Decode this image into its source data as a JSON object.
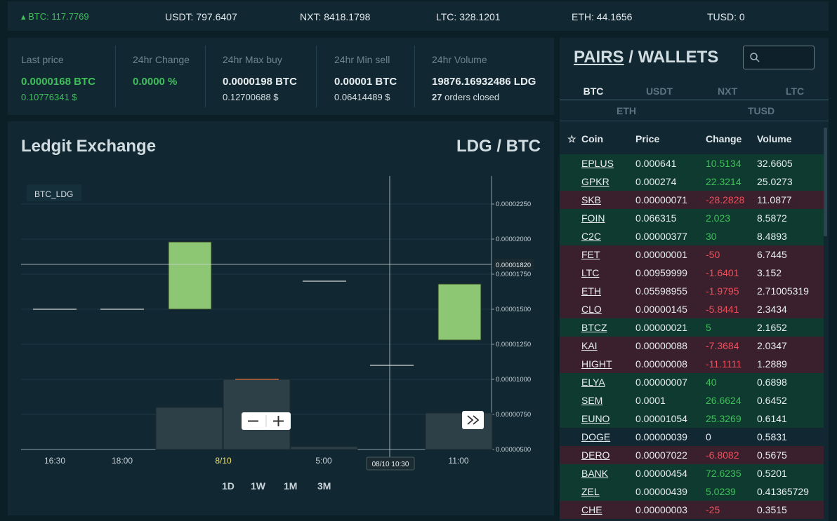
{
  "ticker": [
    {
      "label": "▴ BTC: 117.7769",
      "trend": "up"
    },
    {
      "label": "USDT: 797.6407",
      "trend": "none"
    },
    {
      "label": "NXT: 8418.1798",
      "trend": "none"
    },
    {
      "label": "LTC: 328.1201",
      "trend": "none"
    },
    {
      "label": "ETH: 44.1656",
      "trend": "none"
    },
    {
      "label": "TUSD: 0",
      "trend": "none"
    }
  ],
  "stats": {
    "last_price": {
      "label": "Last price",
      "value": "0.0000168 BTC",
      "sub": "0.10776341 $"
    },
    "change": {
      "label": "24hr Change",
      "value": "0.0000 %"
    },
    "max_buy": {
      "label": "24hr Max buy",
      "value": "0.0000198 BTC",
      "sub": "0.12700688 $"
    },
    "min_sell": {
      "label": "24hr Min sell",
      "value": "0.00001 BTC",
      "sub": "0.06414489 $"
    },
    "volume": {
      "label": "24hr Volume",
      "value": "19876.16932486 LDG",
      "orders_count": "27",
      "orders_label": "orders closed"
    }
  },
  "chart_panel": {
    "title": "Ledgit Exchange",
    "pair": "LDG / BTC",
    "periods": [
      "1D",
      "1W",
      "1M",
      "3M"
    ]
  },
  "chart_data": {
    "type": "candlestick",
    "symbol": "BTC_LDG",
    "x_ticks": [
      "16:30",
      "18:00",
      "8/10",
      "5:00",
      "10:30",
      "11:00"
    ],
    "y_ticks": [
      "0.00002250",
      "0.00002000",
      "0.00001750",
      "0.00001500",
      "0.00001250",
      "0.00001000",
      "0.00000750",
      "0.00000500"
    ],
    "ylim": [
      5e-06,
      2.45e-05
    ],
    "crosshair": {
      "price_label": "0.00001820",
      "price": 1.82e-05,
      "time_label": "08/10 10:30"
    },
    "candles": [
      {
        "time": "16:30",
        "open": 1.5e-05,
        "close": 1.5e-05,
        "volume": 0
      },
      {
        "time": "18:00",
        "open": 1.5e-05,
        "close": 1.5e-05,
        "volume": 0
      },
      {
        "time": "19:30",
        "open": 1.5e-05,
        "close": 1.98e-05,
        "volume": 0.3
      },
      {
        "time": "8/10",
        "open": 1e-05,
        "close": 1e-05,
        "volume": 0.5
      },
      {
        "time": "5:00",
        "open": 1.7e-05,
        "close": 1.7e-05,
        "volume": 0.02
      },
      {
        "time": "10:30",
        "open": 1.1e-05,
        "close": 1.1e-05,
        "volume": 0
      },
      {
        "time": "11:00",
        "open": 1.28e-05,
        "close": 1.68e-05,
        "volume": 0.26
      }
    ],
    "colors": {
      "up": "#8dc774",
      "flat": "#d8d8d8",
      "volume": "#2d4048",
      "grid": "#1e3944"
    }
  },
  "pairs_panel": {
    "pairs_label": "PAIRS",
    "sep": " / ",
    "wallets_label": "WALLETS",
    "tabs_row1": [
      "BTC",
      "USDT",
      "NXT",
      "LTC"
    ],
    "tabs_row2": [
      "ETH",
      "TUSD"
    ],
    "active_tab": "BTC",
    "columns": [
      "Coin",
      "Price",
      "Change",
      "Volume"
    ],
    "rows": [
      {
        "coin": "EPLUS",
        "price": "0.000641",
        "change": "10.5134",
        "volume": "32.6605",
        "dir": "pos"
      },
      {
        "coin": "GPKR",
        "price": "0.000274",
        "change": "22.3214",
        "volume": "25.0273",
        "dir": "pos"
      },
      {
        "coin": "SKB",
        "price": "0.00000071",
        "change": "-28.2828",
        "volume": "11.0877",
        "dir": "neg"
      },
      {
        "coin": "FOIN",
        "price": "0.066315",
        "change": "2.023",
        "volume": "8.5872",
        "dir": "pos"
      },
      {
        "coin": "C2C",
        "price": "0.00000377",
        "change": "30",
        "volume": "8.4893",
        "dir": "pos"
      },
      {
        "coin": "FET",
        "price": "0.00000001",
        "change": "-50",
        "volume": "6.7445",
        "dir": "neg"
      },
      {
        "coin": "LTC",
        "price": "0.00959999",
        "change": "-1.6401",
        "volume": "3.152",
        "dir": "neg"
      },
      {
        "coin": "ETH",
        "price": "0.05598955",
        "change": "-1.9795",
        "volume": "2.71005319",
        "dir": "neg"
      },
      {
        "coin": "CLO",
        "price": "0.00000145",
        "change": "-5.8441",
        "volume": "2.3434",
        "dir": "neg"
      },
      {
        "coin": "BTCZ",
        "price": "0.00000021",
        "change": "5",
        "volume": "2.1652",
        "dir": "pos"
      },
      {
        "coin": "KAI",
        "price": "0.00000088",
        "change": "-7.3684",
        "volume": "2.0347",
        "dir": "neg"
      },
      {
        "coin": "HIGHT",
        "price": "0.00000008",
        "change": "-11.1111",
        "volume": "1.2889",
        "dir": "neg"
      },
      {
        "coin": "ELYA",
        "price": "0.00000007",
        "change": "40",
        "volume": "0.6898",
        "dir": "pos"
      },
      {
        "coin": "SEM",
        "price": "0.0001",
        "change": "26.6624",
        "volume": "0.6452",
        "dir": "pos"
      },
      {
        "coin": "EUNO",
        "price": "0.00001054",
        "change": "25.3269",
        "volume": "0.6141",
        "dir": "pos"
      },
      {
        "coin": "DOGE",
        "price": "0.00000039",
        "change": "0",
        "volume": "0.5831",
        "dir": "neu"
      },
      {
        "coin": "DERO",
        "price": "0.00007022",
        "change": "-6.8082",
        "volume": "0.5675",
        "dir": "neg"
      },
      {
        "coin": "BANK",
        "price": "0.00000454",
        "change": "72.6235",
        "volume": "0.5201",
        "dir": "pos"
      },
      {
        "coin": "ZEL",
        "price": "0.00000439",
        "change": "5.0239",
        "volume": "0.41365729",
        "dir": "pos"
      },
      {
        "coin": "CHE",
        "price": "0.00000003",
        "change": "-25",
        "volume": "0.3515",
        "dir": "neg"
      }
    ]
  }
}
